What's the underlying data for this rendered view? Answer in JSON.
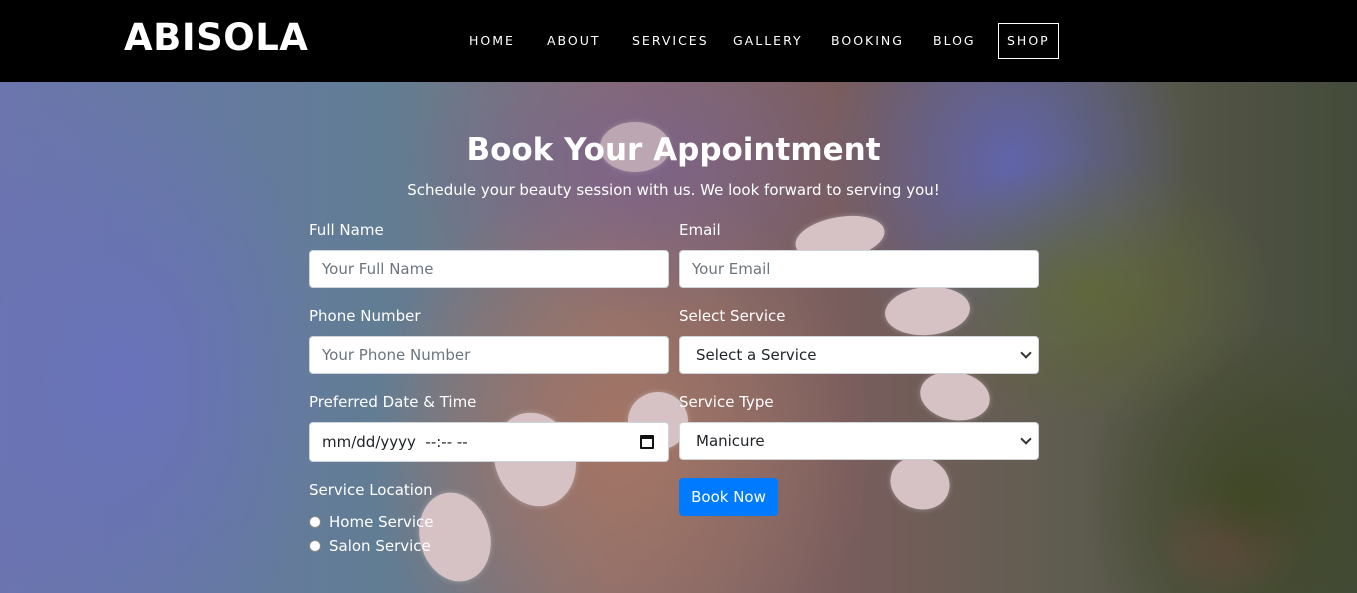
{
  "brand": "ABISOLA",
  "nav": {
    "home": "HOME",
    "about": "ABOUT",
    "services": "SERVICES",
    "gallery": "GALLERY",
    "booking": "BOOKING",
    "blog": "BLOG",
    "shop": "SHOP"
  },
  "form": {
    "title": "Book Your Appointment",
    "subtitle": "Schedule your beauty session with us. We look forward to serving you!",
    "full_name": {
      "label": "Full Name",
      "placeholder": "Your Full Name"
    },
    "email": {
      "label": "Email",
      "placeholder": "Your Email"
    },
    "phone": {
      "label": "Phone Number",
      "placeholder": "Your Phone Number"
    },
    "service": {
      "label": "Select Service",
      "value": "Select a Service"
    },
    "datetime": {
      "label": "Preferred Date & Time",
      "value": "mm/dd/yyyy  --:-- --"
    },
    "service_type": {
      "label": "Service Type",
      "value": "Manicure"
    },
    "location": {
      "label": "Service Location",
      "options": [
        "Home Service",
        "Salon Service"
      ]
    },
    "submit": "Book Now"
  },
  "colors": {
    "navbar": "#000000",
    "button": "#007bff",
    "text_light": "#ffffff"
  }
}
